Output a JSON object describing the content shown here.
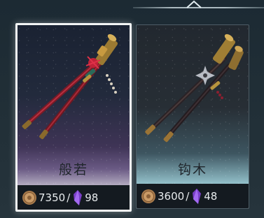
{
  "items": [
    {
      "name": "般若",
      "coin_cost": "7350",
      "separator": "/",
      "gem_cost": "98",
      "selected": true,
      "icon": "crimson-pole-weapon"
    },
    {
      "name": "钩木",
      "coin_cost": "3600",
      "separator": "/",
      "gem_cost": "48",
      "selected": false,
      "icon": "dark-pole-weapon"
    }
  ],
  "currency": {
    "coin_icon": "coin-icon",
    "gem_icon": "purple-crystal-icon"
  },
  "colors": {
    "selected_border": "#f2f4f4",
    "card1_glow": "#6a5a84",
    "card2_glow": "#8fbcc6",
    "gem": "#8a4ed6",
    "coin": "#b8895a"
  }
}
